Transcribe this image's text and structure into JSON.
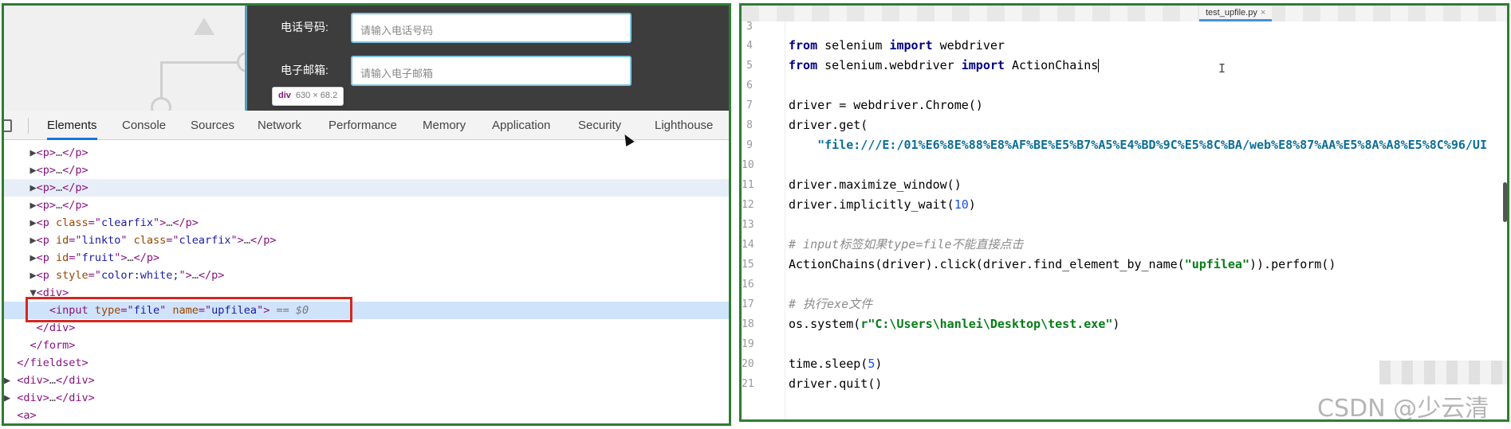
{
  "devtools": {
    "preview": {
      "phone_label": "电话号码:",
      "phone_placeholder": "请输入电话号码",
      "email_label": "电子邮箱:",
      "email_placeholder": "请输入电子邮箱",
      "tooltip_tag": "div",
      "tooltip_dims": "630 × 68.2"
    },
    "tabs": [
      "Elements",
      "Console",
      "Sources",
      "Network",
      "Performance",
      "Memory",
      "Application",
      "Security",
      "Lighthouse"
    ],
    "active_tab": "Elements"
  },
  "editor": {
    "file_tab": "test_upfile.py",
    "close_glyph": "×",
    "line_numbers": [
      "3",
      "4",
      "5",
      "6",
      "7",
      "8",
      "9",
      "10",
      "11",
      "12",
      "13",
      "14",
      "15",
      "16",
      "17",
      "18",
      "19",
      "20",
      "21"
    ],
    "code": {
      "l4_a": "from",
      "l4_b": " selenium ",
      "l4_c": "import",
      "l4_d": " webdriver",
      "l5_a": "from",
      "l5_b": " selenium.webdriver ",
      "l5_c": "import",
      "l5_d": " ActionChains",
      "l7": "driver = webdriver.Chrome()",
      "l8": "driver.get(",
      "l9": "    \"file:///E:/01%E6%8E%88%E8%AF%BE%E5%B7%A5%E4%BD%9C%E5%8C%BA/web%E8%87%AA%E5%8A%A8%E5%8C%96/UI",
      "l11": "driver.maximize_window()",
      "l12_a": "driver.implicitly_wait(",
      "l12_b": "10",
      "l12_c": ")",
      "l14": "# input标签如果type=file不能直接点击",
      "l15_a": "ActionChains(driver).click(driver.find_element_by_name(",
      "l15_b": "\"upfilea\"",
      "l15_c": ")).perform()",
      "l17": "# 执行exe文件",
      "l18_a": "os.system(",
      "l18_b": "r\"C:\\Users\\hanlei\\Desktop\\test.exe\"",
      "l18_c": ")",
      "l20_a": "time.sleep(",
      "l20_b": "5",
      "l20_c": ")",
      "l21": "driver.quit()"
    }
  },
  "watermark": "CSDN @少云清",
  "colors": {
    "panel_border": "#2e7d32",
    "highlight_box": "#d7261e",
    "active_tab_underline": "#1a73e8"
  }
}
